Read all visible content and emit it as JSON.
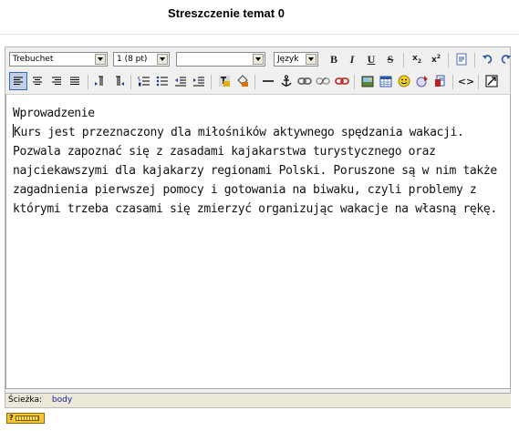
{
  "header": {
    "title": "Streszczenie temat 0"
  },
  "toolbar": {
    "font_family": "Trebuchet",
    "font_size": "1 (8 pt)",
    "format": "",
    "language": "Język",
    "bold_label": "B",
    "italic_label": "I",
    "underline_label": "U",
    "strike_label": "S",
    "sub_label": "x",
    "sub_mark": "2",
    "sup_label": "x",
    "sup_mark": "2",
    "hr_icon": "horizontal-rule-icon",
    "source_label": "<>"
  },
  "content": {
    "heading": "Wprowadzenie",
    "body": "Kurs jest przeznaczony dla miłośników aktywnego spędzania wakacji. Pozwala zapoznać się z zasadami kajakarstwa turystycznego oraz najciekawszymi dla kajakarzy regionami Polski. Poruszone są w nim także zagadnienia pierwszej pomocy i gotowania na biwaku, czyli problemy z którymi trzeba czasami się zmierzyć organizując wakacje na własną rękę."
  },
  "status": {
    "path_label": "Ścieżka:",
    "path_value": "body"
  },
  "help": {
    "symbol": "?"
  },
  "colors": {
    "toolbar_bg": "#f0f0ee",
    "active_button": "#c2cfe5",
    "link": "#1a1aa8",
    "badge": "#f4c431"
  }
}
